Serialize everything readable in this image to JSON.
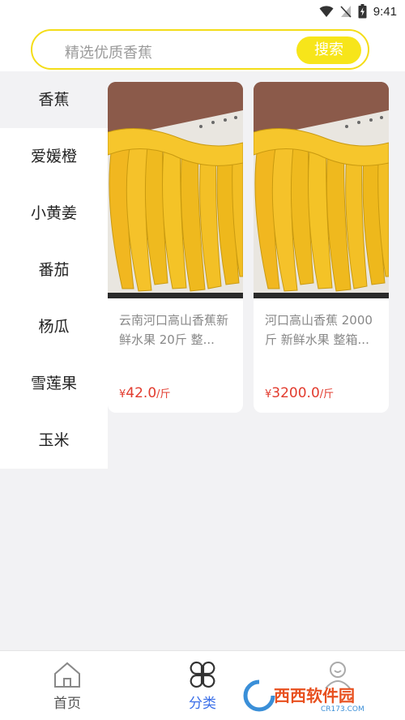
{
  "status_bar": {
    "time": "9:41",
    "icons": [
      "wifi-icon",
      "no-signal-icon",
      "battery-icon"
    ]
  },
  "search": {
    "placeholder": "精选优质香蕉",
    "button_label": "搜索",
    "accent_color": "#f7e51a"
  },
  "sidebar": {
    "items": [
      {
        "label": "香蕉",
        "active": true
      },
      {
        "label": "爱媛橙"
      },
      {
        "label": "小黄姜"
      },
      {
        "label": "番茄"
      },
      {
        "label": "杨瓜"
      },
      {
        "label": "雪莲果"
      },
      {
        "label": "玉米"
      }
    ]
  },
  "products": [
    {
      "title": "云南河口高山香蕉新鲜水果 20斤 整...",
      "currency": "¥",
      "price": "42.0",
      "unit": "/斤"
    },
    {
      "title": "河口高山香蕉 2000斤 新鲜水果 整箱...",
      "currency": "¥",
      "price": "3200.0",
      "unit": "/斤"
    }
  ],
  "tabbar": {
    "tabs": [
      {
        "label": "首页",
        "icon": "home-icon"
      },
      {
        "label": "分类",
        "icon": "category-icon",
        "active": true
      },
      {
        "label": "",
        "icon": "profile-icon"
      }
    ],
    "active_color": "#3a6ee8"
  },
  "watermark": {
    "text": "西西软件园",
    "subtext": "CR173.COM"
  }
}
